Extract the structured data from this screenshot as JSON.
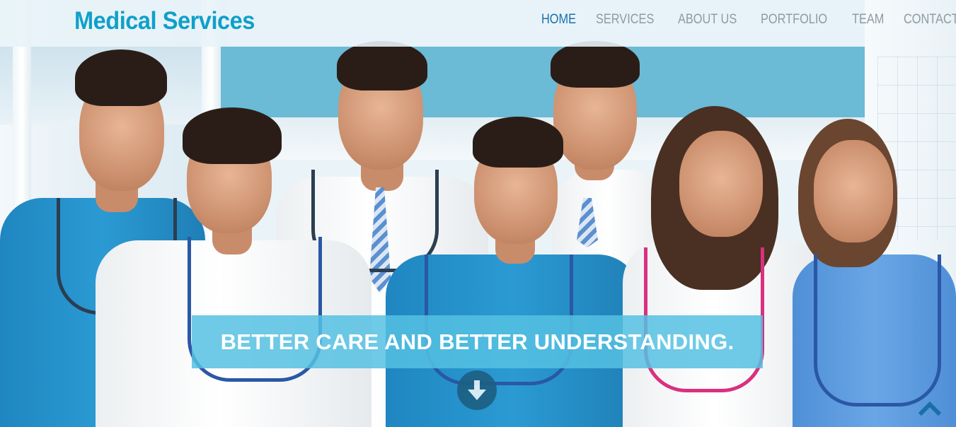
{
  "brand": {
    "name": "Medical Services"
  },
  "nav": {
    "items": [
      {
        "label": "HOME",
        "active": true
      },
      {
        "label": "SERVICES",
        "active": false
      },
      {
        "label": "ABOUT US",
        "active": false
      },
      {
        "label": "PORTFOLIO",
        "active": false
      },
      {
        "label": "TEAM",
        "active": false
      },
      {
        "label": "CONTACT US",
        "active": false
      }
    ]
  },
  "hero": {
    "tagline": "BETTER CARE AND BETTER UNDERSTANDING.",
    "scroll_down_icon": "arrow-down-circle-icon",
    "back_to_top_icon": "chevron-up-icon"
  },
  "colors": {
    "brand": "#0fa0c9",
    "nav_active": "#1b6fa8",
    "nav_inactive": "#8e9aa2",
    "tagline_bg": "#55c1e2",
    "scroll_button": "#1d5f82"
  }
}
